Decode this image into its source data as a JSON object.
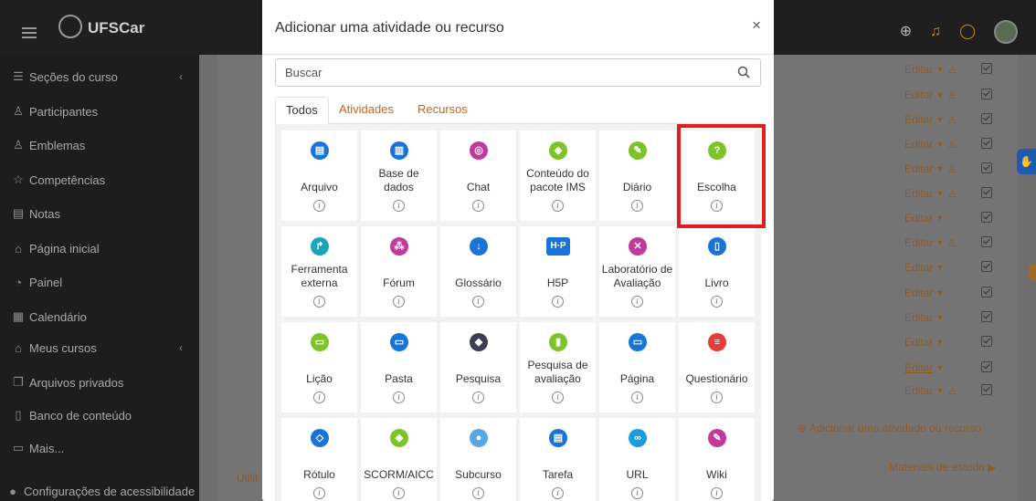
{
  "header": {
    "brand": "UFSCar",
    "icons": [
      "menu-icon",
      "globe-icon",
      "bell-icon",
      "chat-icon",
      "avatar"
    ]
  },
  "sidebar": {
    "items": [
      {
        "label": "Seções do curso",
        "icon": "list-icon",
        "chevron": true
      },
      {
        "label": "Participantes",
        "icon": "users-icon"
      },
      {
        "label": "Emblemas",
        "icon": "badge-icon"
      },
      {
        "label": "Competências",
        "icon": "star-icon"
      },
      {
        "label": "Notas",
        "icon": "grades-icon"
      },
      {
        "label": "Página inicial",
        "icon": "home-icon"
      },
      {
        "label": "Painel",
        "icon": "dashboard-icon"
      },
      {
        "label": "Calendário",
        "icon": "calendar-icon"
      },
      {
        "label": "Meus cursos",
        "icon": "graduation-icon",
        "chevron": true
      },
      {
        "label": "Arquivos privados",
        "icon": "files-icon"
      },
      {
        "label": "Banco de conteúdo",
        "icon": "content-bank-icon"
      },
      {
        "label": "Mais...",
        "icon": "folder-icon"
      },
      {
        "label": "Configurações de acessibilidade",
        "icon": "accessibility-icon"
      }
    ]
  },
  "background": {
    "edit_label": "Editar",
    "utilities_label": "Utilit",
    "add_activity_label": "Adicionar uma atividade ou recurso",
    "materials_label": "Materiais de estudo ▶"
  },
  "modal": {
    "title": "Adicionar uma atividade ou recurso",
    "close_label": "×",
    "search": {
      "placeholder": "Buscar"
    },
    "tabs": [
      {
        "label": "Todos",
        "active": true
      },
      {
        "label": "Atividades",
        "active": false
      },
      {
        "label": "Recursos",
        "active": false
      }
    ],
    "info_glyph": "i",
    "modules": [
      {
        "label": "Arquivo",
        "icon": "file-icon",
        "color": "#1a73d9",
        "glyph": "▤"
      },
      {
        "label": "Base de dados",
        "icon": "database-icon",
        "color": "#1a73d9",
        "glyph": "▥"
      },
      {
        "label": "Chat",
        "icon": "chat-bubbles-icon",
        "color": "#c0399b",
        "glyph": "◎"
      },
      {
        "label": "Conteúdo do pacote IMS",
        "icon": "package-icon",
        "color": "#7cc42a",
        "glyph": "◈"
      },
      {
        "label": "Diário",
        "icon": "journal-icon",
        "color": "#7cc42a",
        "glyph": "✎"
      },
      {
        "label": "Escolha",
        "icon": "question-icon",
        "color": "#7cc42a",
        "glyph": "?"
      },
      {
        "label": "Ferramenta externa",
        "icon": "external-tool-icon",
        "color": "#1aa5b8",
        "glyph": "↱"
      },
      {
        "label": "Fórum",
        "icon": "forum-icon",
        "color": "#c0399b",
        "glyph": "⁂"
      },
      {
        "label": "Glossário",
        "icon": "glossary-icon",
        "color": "#1a73d9",
        "glyph": "↓"
      },
      {
        "label": "H5P",
        "icon": "h5p-icon",
        "color": "#1a73d9",
        "glyph": "H·P"
      },
      {
        "label": "Laboratório de Avaliação",
        "icon": "workshop-icon",
        "color": "#c0399b",
        "glyph": "✕"
      },
      {
        "label": "Livro",
        "icon": "book-icon",
        "color": "#1a73d9",
        "glyph": "▯"
      },
      {
        "label": "Lição",
        "icon": "lesson-icon",
        "color": "#7cc42a",
        "glyph": "▭"
      },
      {
        "label": "Pasta",
        "icon": "folder-icon",
        "color": "#1a73d9",
        "glyph": "▭"
      },
      {
        "label": "Pesquisa",
        "icon": "survey-icon",
        "color": "#3d3d55",
        "glyph": "◆"
      },
      {
        "label": "Pesquisa de avaliação",
        "icon": "feedback-icon",
        "color": "#7cc42a",
        "glyph": "▮"
      },
      {
        "label": "Página",
        "icon": "page-icon",
        "color": "#1a73d9",
        "glyph": "▭"
      },
      {
        "label": "Questionário",
        "icon": "quiz-icon",
        "color": "#e63c3c",
        "glyph": "≡"
      },
      {
        "label": "Rótulo",
        "icon": "label-icon",
        "color": "#1a73d9",
        "glyph": "◇"
      },
      {
        "label": "SCORM/AICC",
        "icon": "scorm-icon",
        "color": "#7cc42a",
        "glyph": "◈"
      },
      {
        "label": "Subcurso",
        "icon": "subcourse-icon",
        "color": "#5aa8e0",
        "glyph": "●"
      },
      {
        "label": "Tarefa",
        "icon": "assignment-icon",
        "color": "#1a73d9",
        "glyph": "▤"
      },
      {
        "label": "URL",
        "icon": "link-icon",
        "color": "#1a9de0",
        "glyph": "∞"
      },
      {
        "label": "Wiki",
        "icon": "wiki-icon",
        "color": "#c0399b",
        "glyph": "✎"
      }
    ]
  }
}
